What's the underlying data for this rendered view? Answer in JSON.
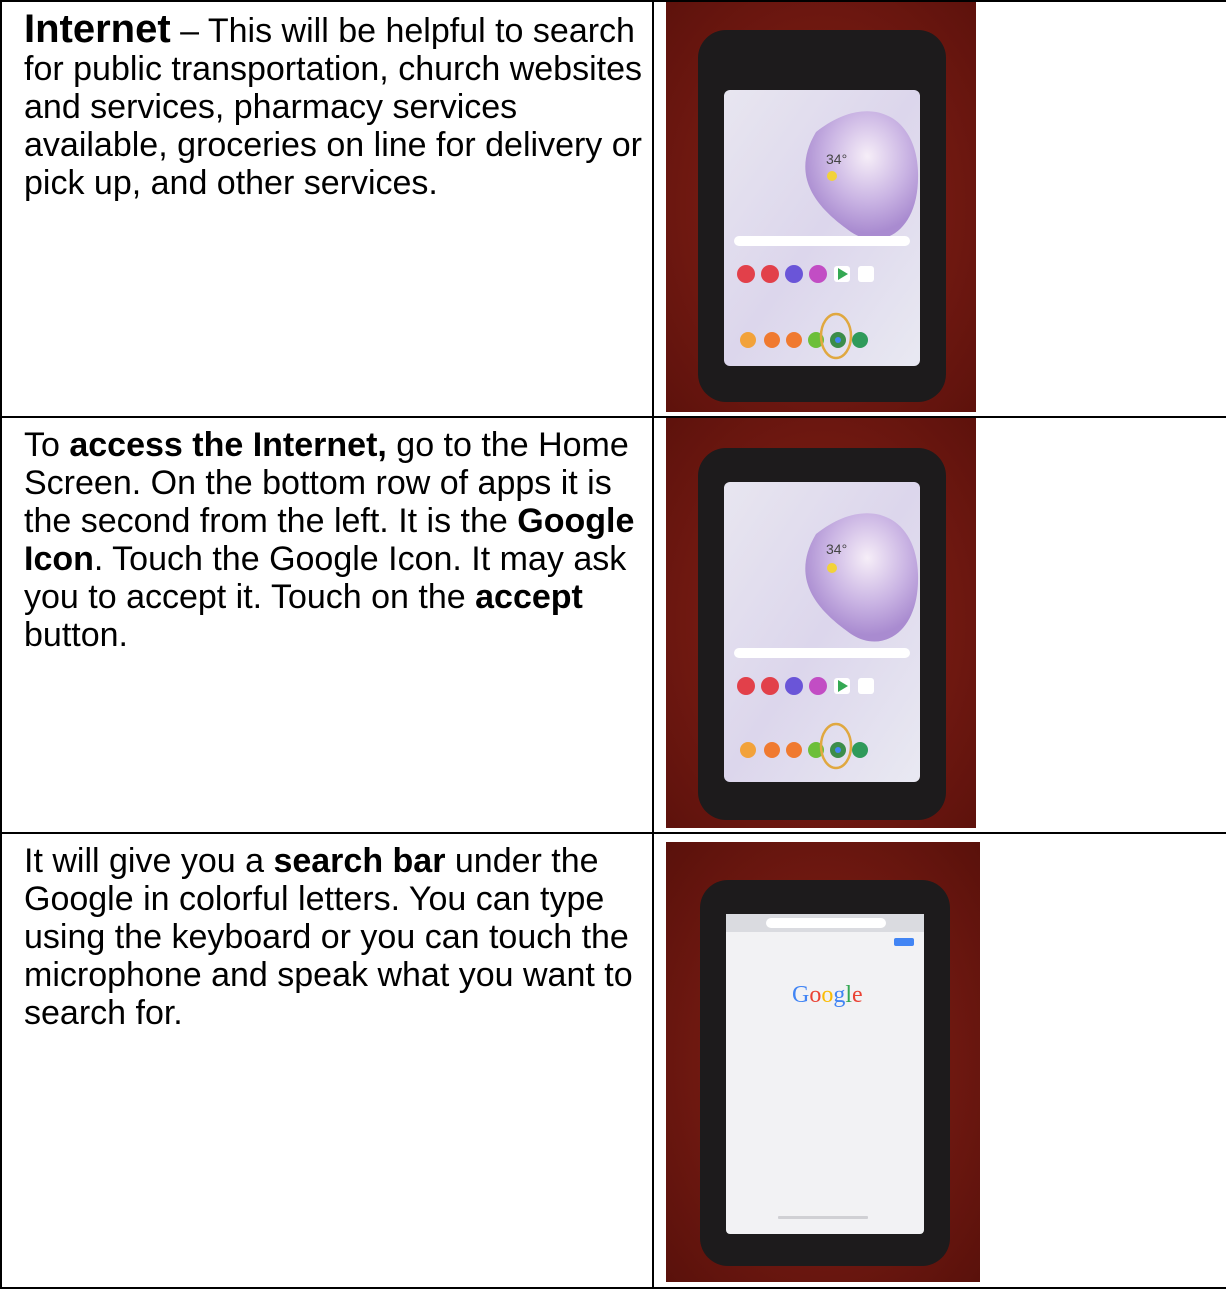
{
  "rows": [
    {
      "heading": "Internet",
      "text_after_heading": " – This will be helpful to search for public transportation, church websites and services, pharmacy services available, groceries on line for delivery or pick up, and other services.",
      "photo": {
        "subject": "tablet-home-screen",
        "temperature_text": "34°",
        "highlighted_app": "chrome-icon",
        "highlight_color": "#e0a840"
      }
    },
    {
      "parts": [
        "To ",
        "access the Internet,",
        " go to the Home Screen. On the bottom row of apps it is the second from the left.  It is the ",
        "Google Icon",
        ". Touch the Google Icon. It may ask you to accept it. Touch on the ",
        "accept",
        " button."
      ],
      "photo": {
        "subject": "tablet-home-screen",
        "temperature_text": "34°",
        "highlighted_app": "chrome-icon",
        "highlight_color": "#e0a840"
      }
    },
    {
      "parts": [
        "It will give you a ",
        "search bar",
        " under the Google in colorful letters. You can type using the keyboard or you can touch the microphone and speak what you want to search for."
      ],
      "photo": {
        "subject": "tablet-google-search",
        "logo_text": "Google"
      }
    }
  ],
  "colors": {
    "background_red": "#7a1a14",
    "tablet_case": "#1d1b1c",
    "screen_gray": "#e7e8f0",
    "google_blue": "#4285f4",
    "google_red": "#ea4335",
    "google_yellow": "#fbbc05",
    "google_green": "#34a853"
  }
}
